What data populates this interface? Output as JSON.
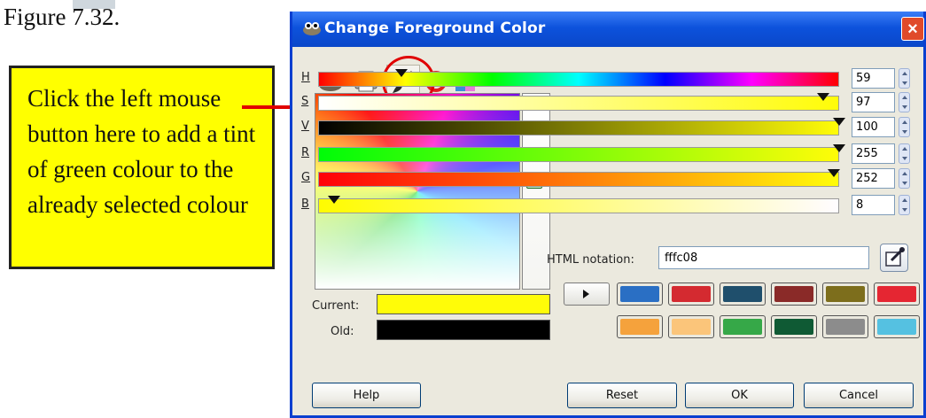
{
  "figure": {
    "caption": "Figure 7.32."
  },
  "note": {
    "text": "Click the left mouse button here to add a tint of green colour to the already selected colour"
  },
  "dialog": {
    "title": "Change Foreground Color",
    "close_label": "×"
  },
  "tabs": [
    {
      "icon": "gimp-wilber-icon",
      "selected": false
    },
    {
      "icon": "printer-cmyk-icon",
      "selected": false
    },
    {
      "icon": "paintbrush-icon",
      "selected": true
    },
    {
      "icon": "color-wheel-icon",
      "selected": false
    },
    {
      "icon": "palette-icon",
      "selected": false
    }
  ],
  "current": {
    "label": "Current:",
    "color": "#fffc08"
  },
  "old": {
    "label": "Old:",
    "color": "#000000"
  },
  "channels": [
    {
      "label": "H",
      "value": "59",
      "level": 0.16
    },
    {
      "label": "S",
      "value": "97",
      "level": 0.97
    },
    {
      "label": "V",
      "value": "100",
      "level": 1.0
    },
    {
      "label": "R",
      "value": "255",
      "level": 1.0
    },
    {
      "label": "G",
      "value": "252",
      "level": 0.99
    },
    {
      "label": "B",
      "value": "8",
      "level": 0.03
    }
  ],
  "html_notation": {
    "label": "HTML notation:",
    "value": "fffc08"
  },
  "history": [
    "#2a6fc4",
    "#d42a30",
    "#1f4f6c",
    "#8a2a28",
    "#7d6e1c",
    "#e52632",
    "#f5a23c",
    "#fbc57a",
    "#36a848",
    "#0f5a34",
    "#8c8c8c",
    "#55c1e1"
  ],
  "buttons": {
    "help": "Help",
    "reset": "Reset",
    "ok": "OK",
    "cancel": "Cancel"
  }
}
